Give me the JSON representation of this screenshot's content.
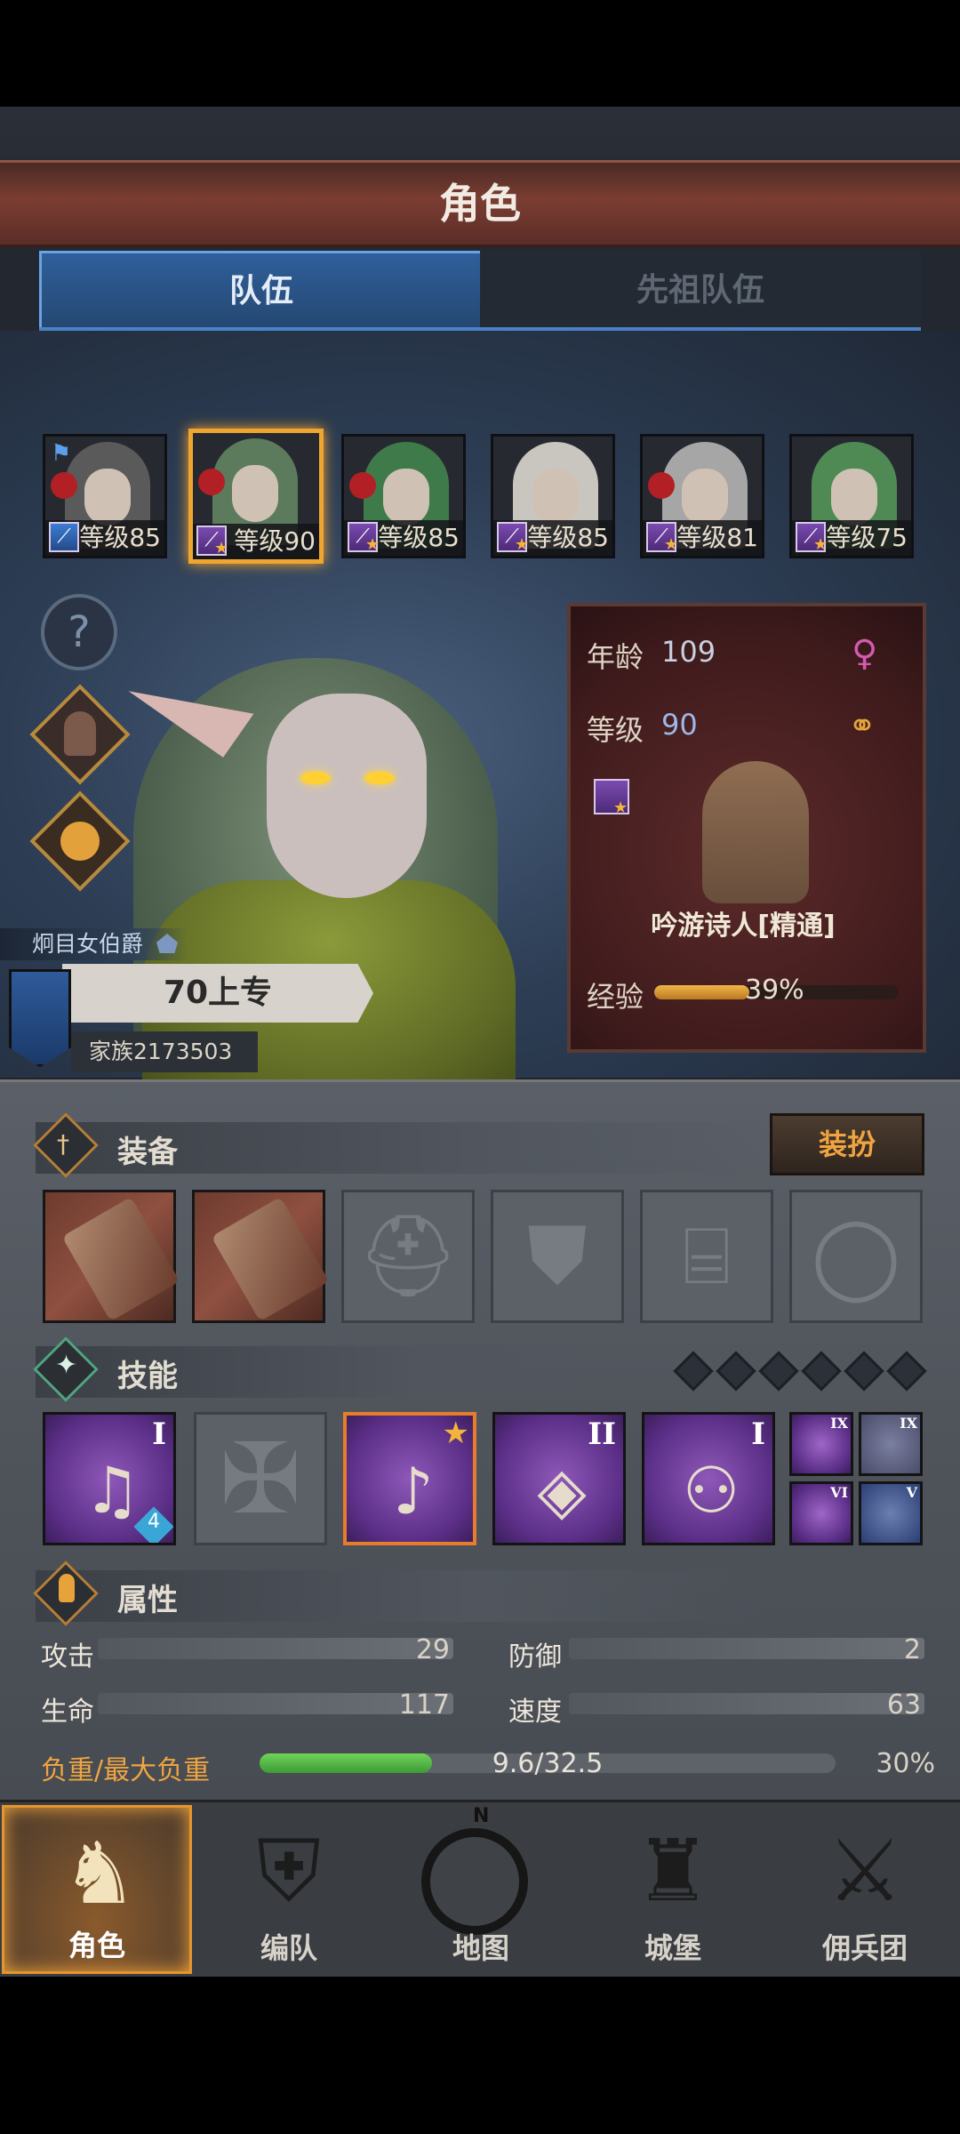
{
  "header": {
    "title": "角色"
  },
  "tabs": [
    {
      "label": "队伍",
      "active": true
    },
    {
      "label": "先祖队伍",
      "active": false
    }
  ],
  "roster": [
    {
      "level": "等级85",
      "hair": "#5a5a5a",
      "class_color": "blue",
      "flag": true,
      "red": true
    },
    {
      "level": "等级90",
      "hair": "#5c7a5c",
      "class_color": "purple",
      "selected": true,
      "red": true
    },
    {
      "level": "等级85",
      "hair": "#3f7a4a",
      "class_color": "purple",
      "red": true
    },
    {
      "level": "等级85",
      "hair": "#c9c6c0",
      "class_color": "purple"
    },
    {
      "level": "等级81",
      "hair": "#a6a6a6",
      "class_color": "purple",
      "red": true
    },
    {
      "level": "等级75",
      "hair": "#4f8a55",
      "class_color": "purple"
    }
  ],
  "side_icons": [
    "help-icon",
    "character-silhouette-icon",
    "potion-icon"
  ],
  "character": {
    "title": "炯目女伯爵",
    "rank": "70上专",
    "family": "家族2173503"
  },
  "info": {
    "age_label": "年龄",
    "age": "109",
    "level_label": "等级",
    "level": "90",
    "class_name": "吟游诗人[精通]",
    "exp_label": "经验",
    "exp_percent": "39%",
    "exp_fraction": 0.39
  },
  "equipment": {
    "label": "装备",
    "dress_button": "装扮",
    "slots": [
      "weapon-1",
      "weapon-2",
      "helmet",
      "armor",
      "boots",
      "ring"
    ]
  },
  "skills": {
    "label": "技能",
    "list": [
      {
        "numeral": "I",
        "badge": "4"
      },
      {
        "numeral": "",
        "empty": true
      },
      {
        "numeral": "",
        "starred": true
      },
      {
        "numeral": "II"
      },
      {
        "numeral": "I"
      }
    ],
    "passives": [
      "IX",
      "IX",
      "VI",
      "V"
    ]
  },
  "attributes": {
    "label": "属性",
    "attack_label": "攻击",
    "attack": "29",
    "defense_label": "防御",
    "defense": "2",
    "hp_label": "生命",
    "hp": "117",
    "speed_label": "速度",
    "speed": "63",
    "load_label": "负重/最大负重",
    "load": "9.6/32.5",
    "load_percent": "30%",
    "load_fraction": 0.3
  },
  "nav": [
    {
      "label": "角色",
      "active": true
    },
    {
      "label": "编队"
    },
    {
      "label": "地图"
    },
    {
      "label": "城堡"
    },
    {
      "label": "佣兵团"
    }
  ],
  "compass": "N"
}
